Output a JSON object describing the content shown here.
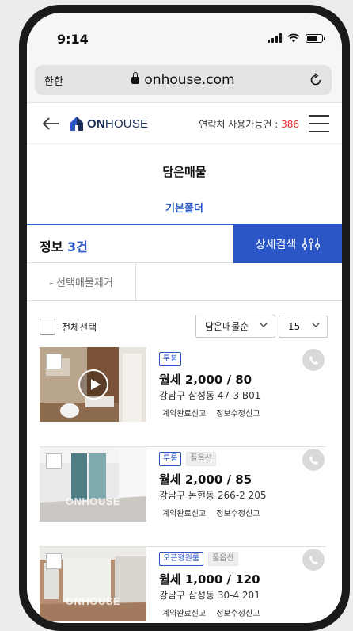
{
  "status_bar": {
    "time": "9:14"
  },
  "browser": {
    "aa_label": "한한",
    "url": "onhouse.com"
  },
  "header": {
    "logo_on": "ON",
    "logo_house": "HOUSE",
    "contact_label": "연락처 사용가능건 : ",
    "contact_count": "386"
  },
  "page": {
    "title": "담은매물",
    "folder": "기본폴더"
  },
  "toolbar": {
    "info_label": "정보 ",
    "info_count": "3건",
    "detail_search_label": "상세검색",
    "remove_label": "- 선택매물제거",
    "select_all_label": "전체선택",
    "sort_selected": "담은매물순",
    "count_selected": "15"
  },
  "listings": [
    {
      "tags": [
        "투룸"
      ],
      "price": "월세 2,000 / 80",
      "address": "강남구 삼성동 47-3 B01",
      "link1": "계약완료신고",
      "link2": "정보수정신고",
      "has_video": true,
      "watermark": ""
    },
    {
      "tags": [
        "투룸",
        "풀옵션"
      ],
      "price": "월세 2,000 / 85",
      "address": "강남구 논현동 266-2 205",
      "link1": "계약완료신고",
      "link2": "정보수정신고",
      "has_video": false,
      "watermark": "ONHOUSE"
    },
    {
      "tags": [
        "오픈형원룸",
        "풀옵션"
      ],
      "price": "월세 1,000 / 120",
      "address": "강남구 삼성동 30-4 201",
      "link1": "계약완료신고",
      "link2": "정보수정신고",
      "has_video": false,
      "watermark": "ONHOUSE"
    }
  ],
  "colors": {
    "accent": "#2a56c6",
    "count_red": "#e03030"
  },
  "icons": {
    "back": "arrow-left-icon",
    "menu": "hamburger-icon",
    "filter": "sliders-icon",
    "call": "phone-icon",
    "reload": "reload-icon",
    "lock": "lock-icon"
  }
}
